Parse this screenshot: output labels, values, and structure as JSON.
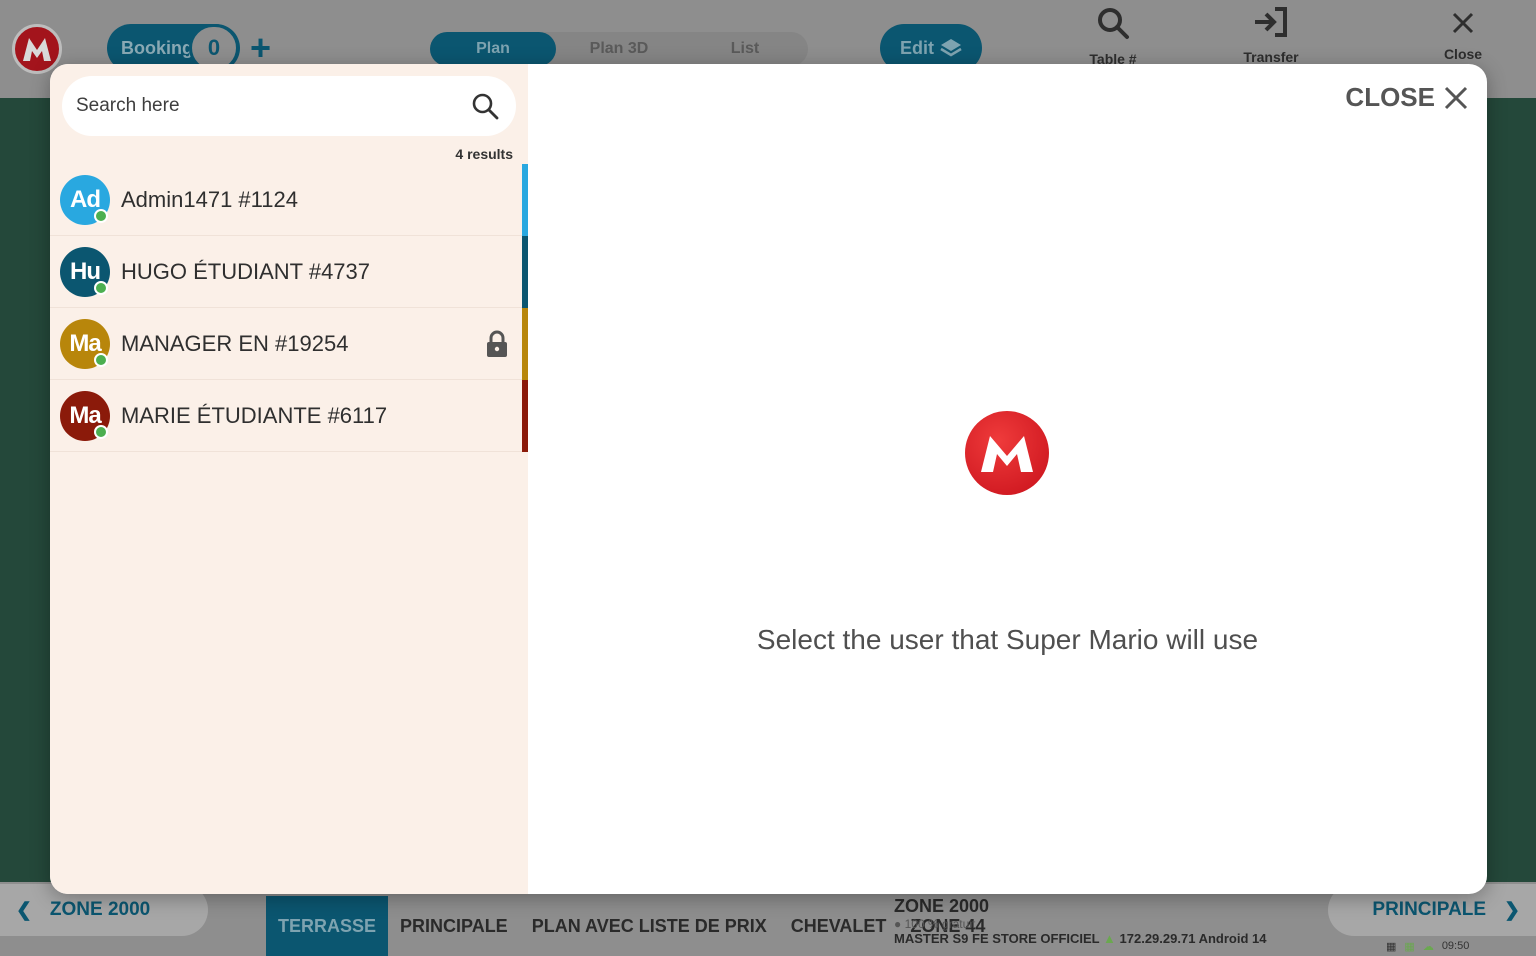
{
  "background": {
    "booking": {
      "label": "Booking",
      "count": "0"
    },
    "view_tabs": [
      {
        "label": "Plan",
        "active": true
      },
      {
        "label": "Plan 3D",
        "active": false
      },
      {
        "label": "List",
        "active": false
      }
    ],
    "edit_label": "Edit",
    "actions": {
      "table": "Table #",
      "transfer": "Transfer",
      "close": "Close"
    },
    "zone_left": "ZONE 2000",
    "zone_tabs": [
      {
        "label": "TERRASSE",
        "active": true
      },
      {
        "label": "PRINCIPALE",
        "active": false
      },
      {
        "label": "PLAN AVEC LISTE DE PRIX",
        "active": false
      },
      {
        "label": "CHEVALET",
        "active": false
      },
      {
        "label": "ZONE 44",
        "active": false
      }
    ],
    "zone_info": {
      "title": "ZONE 2000",
      "subtitle": "100 % gratuit",
      "device": "MASTER S9 FE STORE OFFICIEL",
      "ip": "172.29.29.71",
      "os": "Android 14"
    },
    "zone_right": "PRINCIPALE",
    "time": "09:50"
  },
  "modal": {
    "search": {
      "placeholder": "Search here",
      "value": ""
    },
    "results_label": "4 results",
    "users": [
      {
        "initials": "Ad",
        "name": "Admin1471 #1124",
        "color": "#29a8e0",
        "accent": "#29a8e0",
        "locked": false
      },
      {
        "initials": "Hu",
        "name": "HUGO ÉTUDIANT #4737",
        "color": "#0b5670",
        "accent": "#0b5670",
        "locked": false
      },
      {
        "initials": "Ma",
        "name": "MANAGER EN #19254",
        "color": "#b8860b",
        "accent": "#b8860b",
        "locked": true
      },
      {
        "initials": "Ma",
        "name": "MARIE ÉTUDIANTE #6117",
        "color": "#8b1a0a",
        "accent": "#8b1a0a",
        "locked": false
      }
    ],
    "close_label": "CLOSE",
    "instruction": "Select the user that Super Mario will use"
  }
}
